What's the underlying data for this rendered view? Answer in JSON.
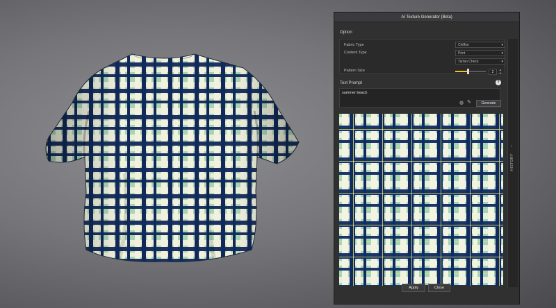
{
  "panel": {
    "title": "AI Texture Generator (Beta)",
    "option_label": "Option",
    "fabric_type": {
      "label": "Fabric Type",
      "value": "Chiffon"
    },
    "content_type": {
      "label": "Content Type",
      "value": "Print"
    },
    "pattern": {
      "value": "Tartan Check"
    },
    "pattern_size": {
      "label": "Pattern Size",
      "value": "2",
      "level": 0.4
    },
    "text_prompt": {
      "label": "Text Prompt",
      "value": "summer beach"
    },
    "generate_label": "Generate",
    "side_tab_label": "HISTORY",
    "apply_label": "Apply",
    "close_label": "Close"
  },
  "icons": {
    "help": "help-circle-icon",
    "style": "style-circle-icon",
    "pick": "eyedropper-icon",
    "collapse": "chevron-left-icon"
  },
  "colors": {
    "accent": "#f0c419",
    "fabric_mint": "#a4d6b6",
    "fabric_navy": "#13285a",
    "fabric_cream": "#f1f1de"
  }
}
